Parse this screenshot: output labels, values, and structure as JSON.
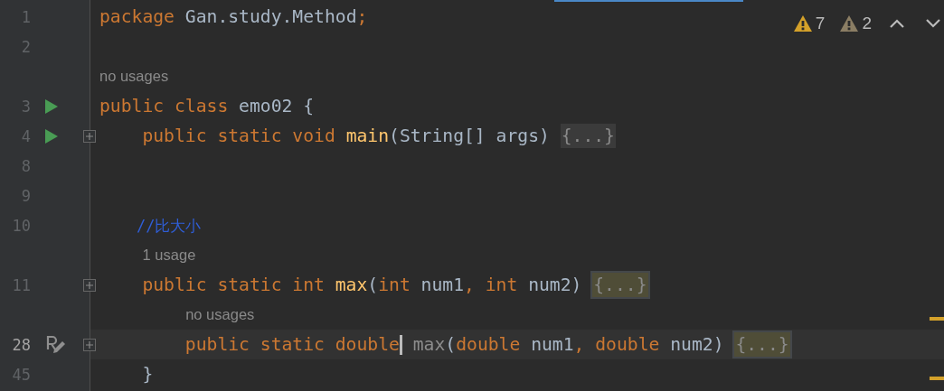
{
  "editor": {
    "lines": [
      {
        "kind": "code",
        "number": "1",
        "current": false,
        "runnable": false,
        "rename_hint": false,
        "folded": false,
        "segments": [
          {
            "kind": "code",
            "tokens": [
              {
                "kind": "keyword",
                "text": "package"
              },
              {
                "kind": "plain",
                "text": " Gan.study.Method"
              },
              {
                "kind": "keyword",
                "text": ";"
              }
            ]
          }
        ]
      },
      {
        "kind": "code",
        "number": "2",
        "current": false,
        "runnable": false,
        "rename_hint": false,
        "folded": false
      },
      {
        "kind": "hint",
        "text": "no usages"
      },
      {
        "kind": "code",
        "number": "3",
        "current": false,
        "runnable": true,
        "rename_hint": false,
        "folded": false,
        "segments": [
          {
            "kind": "code",
            "tokens": [
              {
                "kind": "keyword",
                "text": "public class "
              },
              {
                "kind": "plain",
                "text": "emo02 {"
              }
            ]
          }
        ]
      },
      {
        "kind": "code",
        "number": "4",
        "current": false,
        "runnable": true,
        "rename_hint": false,
        "folded": true,
        "segments": [
          {
            "kind": "code",
            "tokens": [
              {
                "kind": "keyword",
                "text": "    public static void "
              },
              {
                "kind": "method",
                "text": "main"
              },
              {
                "kind": "plain",
                "text": "(String[] args) "
              }
            ]
          },
          {
            "kind": "fold",
            "text": "{...}",
            "highlighted": false
          }
        ]
      },
      {
        "kind": "code",
        "number": "8",
        "current": false,
        "runnable": false,
        "rename_hint": false,
        "folded": false
      },
      {
        "kind": "code",
        "number": "9",
        "current": false,
        "runnable": false,
        "rename_hint": false,
        "folded": false
      },
      {
        "kind": "code",
        "number": "10",
        "current": false,
        "runnable": false,
        "rename_hint": false,
        "folded": false,
        "segments": [
          {
            "kind": "code",
            "tokens": [
              {
                "kind": "comment",
                "text": "    //比大小"
              }
            ]
          }
        ]
      },
      {
        "kind": "hint",
        "text": "1 usage"
      },
      {
        "kind": "code",
        "number": "11",
        "current": false,
        "runnable": false,
        "rename_hint": false,
        "folded": true,
        "segments": [
          {
            "kind": "code",
            "tokens": [
              {
                "kind": "keyword",
                "text": "    public static int "
              },
              {
                "kind": "method",
                "text": "max"
              },
              {
                "kind": "plain",
                "text": "("
              },
              {
                "kind": "keyword",
                "text": "int"
              },
              {
                "kind": "plain",
                "text": " num1"
              },
              {
                "kind": "keyword",
                "text": ", int"
              },
              {
                "kind": "plain",
                "text": " num2) "
              }
            ]
          },
          {
            "kind": "fold",
            "text": "{...}",
            "highlighted": true
          }
        ]
      },
      {
        "kind": "hint",
        "text": "no usages"
      },
      {
        "kind": "code",
        "number": "28",
        "current": true,
        "runnable": false,
        "rename_hint": true,
        "folded": true,
        "segments": [
          {
            "kind": "code",
            "tokens": [
              {
                "kind": "keyword",
                "text": "        public static double"
              }
            ]
          },
          {
            "kind": "caret"
          },
          {
            "kind": "code",
            "tokens": [
              {
                "kind": "unused",
                "text": " max"
              },
              {
                "kind": "plain",
                "text": "("
              },
              {
                "kind": "keyword",
                "text": "double"
              },
              {
                "kind": "plain",
                "text": " num1"
              },
              {
                "kind": "keyword",
                "text": ", double"
              },
              {
                "kind": "plain",
                "text": " num2) "
              }
            ]
          },
          {
            "kind": "fold",
            "text": "{...}",
            "highlighted": true
          }
        ]
      },
      {
        "kind": "code",
        "number": "45",
        "current": false,
        "runnable": false,
        "rename_hint": false,
        "folded": false,
        "segments": [
          {
            "kind": "code",
            "tokens": [
              {
                "kind": "plain",
                "text": "    }"
              }
            ]
          }
        ]
      }
    ],
    "inspections": [
      {
        "kind": "warning",
        "count": "7"
      },
      {
        "kind": "weak_warning",
        "count": "2"
      }
    ]
  }
}
